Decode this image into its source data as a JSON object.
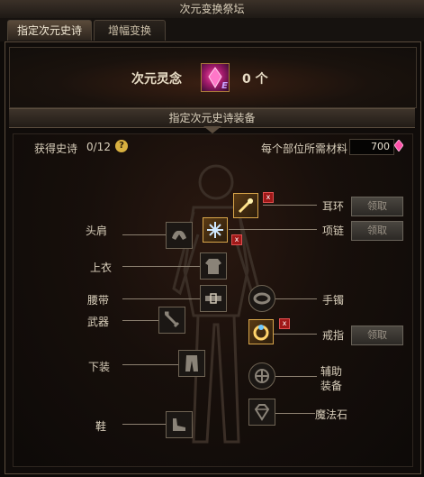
{
  "window": {
    "title": "次元变换祭坛"
  },
  "tabs": [
    {
      "label": "指定次元史诗",
      "active": true
    },
    {
      "label": "增幅变换",
      "active": false
    }
  ],
  "spirit": {
    "label": "次元灵念",
    "count": "0 个",
    "badge": "E"
  },
  "section": {
    "title": "指定次元史诗装备"
  },
  "progress": {
    "label": "获得史诗",
    "value": "0/12",
    "help_icon": "?"
  },
  "material": {
    "label": "每个部位所需材料",
    "value": "700"
  },
  "slots": {
    "earring": "耳环",
    "necklace": "项链",
    "shoulder": "头肩",
    "top": "上衣",
    "belt": "腰带",
    "bracelet": "手镯",
    "weapon": "武器",
    "ring": "戒指",
    "bottom": "下装",
    "support_line1": "辅助",
    "support_line2": "装备",
    "shoes": "鞋",
    "magic_stone": "魔法石"
  },
  "buttons": {
    "claim": "领取"
  },
  "colors": {
    "accent_gold": "#d9a64a",
    "badge_red": "#a01818",
    "panel_bg": "#0d0a08"
  }
}
